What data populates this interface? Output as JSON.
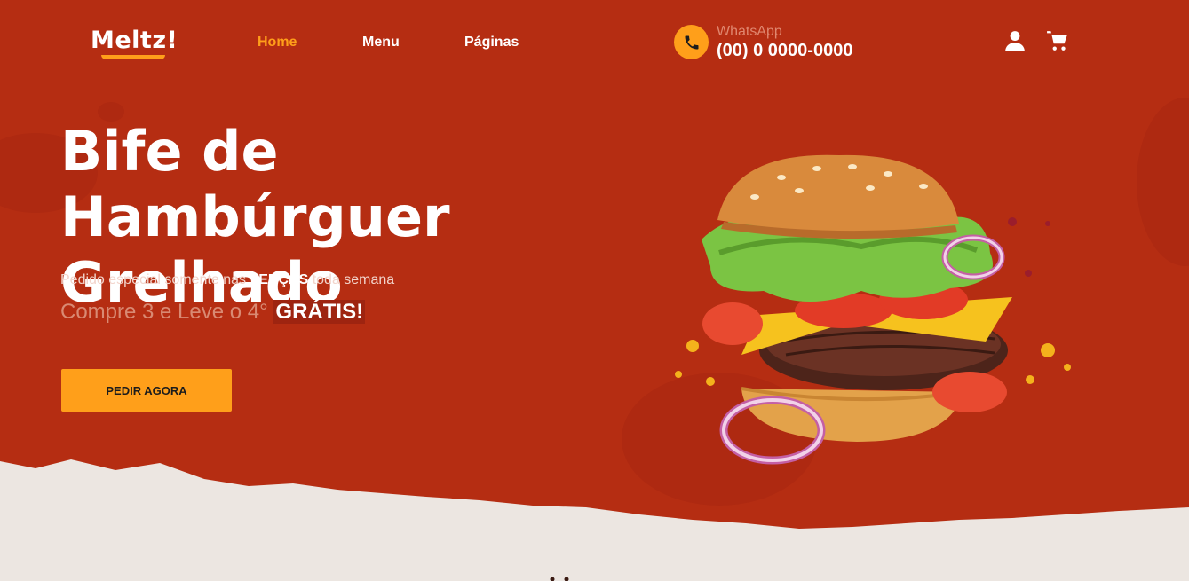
{
  "brand": {
    "logo_text": "Meltz!"
  },
  "nav": {
    "items": [
      {
        "label": "Home",
        "active": true
      },
      {
        "label": "Menu"
      },
      {
        "label": "Páginas"
      }
    ]
  },
  "contact": {
    "label": "WhatsApp",
    "number": "(00) 0 0000-0000",
    "icon": "phone-icon"
  },
  "header_icons": [
    "user-icon",
    "cart-icon"
  ],
  "hero": {
    "title_line1": "Bife de Hambúrguer",
    "title_line2": "Grelhado",
    "sub_prefix": "Pedido especial somente nas ",
    "sub_highlight": "TERÇAS",
    "sub_suffix": " toda semana",
    "offer_prefix": "Compre 3 e Leve o 4° ",
    "offer_highlight": "GRÁTIS!",
    "cta_label": "PEDIR AGORA",
    "image": "burger-illustration"
  },
  "colors": {
    "background": "#b52d12",
    "accent": "#ff9f1a",
    "torn_paper": "#ece6e1"
  }
}
